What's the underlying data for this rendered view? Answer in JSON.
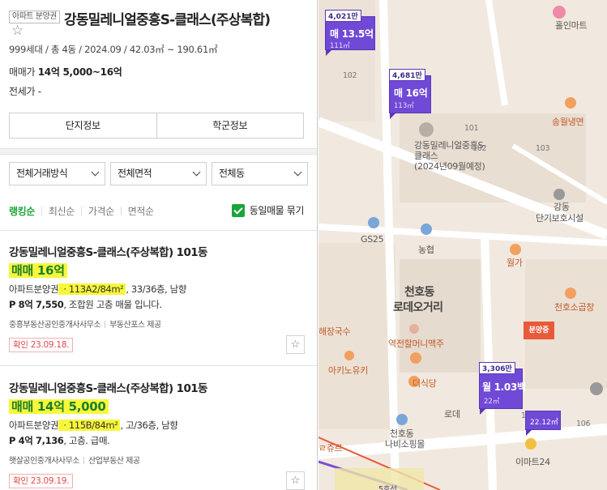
{
  "complex": {
    "badge": "아파트 분양권",
    "name": "강동밀레니얼중흥S-클래스(주상복합)",
    "meta": "999세대 / 총 4동 / 2024.09 / 42.03㎡ ~ 190.61㎡",
    "sale_label": "매매가",
    "sale_value": "14억 5,000~16억",
    "jeonse_label": "전세가",
    "jeonse_value": "-"
  },
  "info_tabs": [
    "단지정보",
    "학군정보"
  ],
  "filters": [
    "전체거래방식",
    "전체면적",
    "전체동"
  ],
  "sort": {
    "items": [
      "랭킹순",
      "최신순",
      "가격순",
      "면적순"
    ],
    "active": 0,
    "group_label": "동일매물 묶기"
  },
  "listings": [
    {
      "title": "강동밀레니얼중흥S-클래스(주상복합) 101동",
      "price": "매매 16억",
      "type": "아파트분양권",
      "area": "113A2/84m²",
      "floor": ", 33/36층, 남향",
      "desc_p": "P 8억 7,550",
      "desc_rest": ", 조합원 고층 매물 입니다.",
      "agent1": "중흥부동산공인중개사사무소",
      "agent2": "부동산포스 제공",
      "confirm": "확인 23.09.18."
    },
    {
      "title": "강동밀레니얼중흥S-클래스(주상복합) 101동",
      "price": "매매 14억 5,000",
      "type": "아파트분양권",
      "area": "115B/84m²",
      "floor": ", 고/36층, 남향",
      "desc_p": "P 4억 7,136",
      "desc_rest": ", 고층. 급매.",
      "agent1": "햇살공인중개사사무소",
      "agent2": "산업부동산 제공",
      "confirm": "확인 23.09.19."
    }
  ],
  "map": {
    "markers": [
      {
        "count": "4,021만",
        "price": "매 13.5억",
        "area": "111㎡"
      },
      {
        "count": "4,681만",
        "price": "매 16억",
        "area": "113㎡"
      },
      {
        "count": "3,306만",
        "price": "월 1.03백",
        "area": "22㎡"
      },
      {
        "count": "",
        "price": "",
        "area": "22.12㎡"
      }
    ],
    "labels": {
      "complex": "강동밀레니얼중흥S-\n클래스\n(2024년09월예정)",
      "complex_l1": "강동밀레니얼중흥S-",
      "complex_l2": "클래스",
      "complex_l3": "(2024년09월예정)",
      "hollmart": "홀인마트",
      "songwol": "송월냉면",
      "gangdong1": "강동",
      "gangdong2": "단기보호시설",
      "gs25": "GS25",
      "nonghyup": "농협",
      "wolga": "월가",
      "cheonho1": "천호동",
      "cheonho2": "로데오거리",
      "sogopchang": "천호소곱창",
      "bunyang": "분양중",
      "haejang": "해장국수",
      "yeokjeon": "역전할머니맥주",
      "akino": "아키노유키",
      "deoksik": "더식당",
      "rode": "로데",
      "naviso1": "천호동",
      "naviso2": "나비소핑몰",
      "emart": "이마트24",
      "kuju": "ㄹ쥬르",
      "n101": "101",
      "n102": "102",
      "n103": "103",
      "n105": "105",
      "n106": "106",
      "n102b": "102",
      "line": "5호선"
    }
  }
}
